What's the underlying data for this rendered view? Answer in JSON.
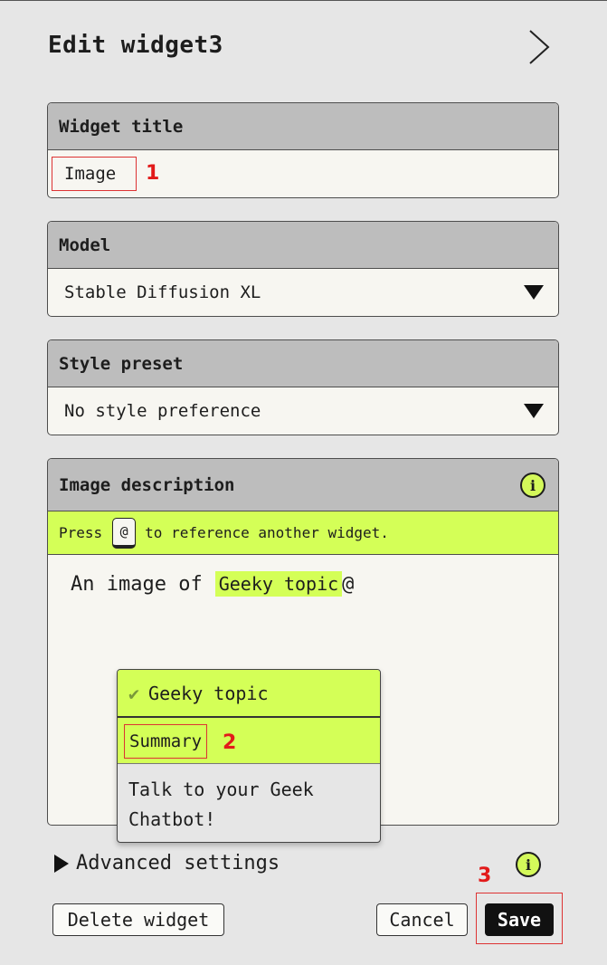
{
  "header": {
    "title": "Edit widget3"
  },
  "widget_title": {
    "label": "Widget title",
    "value": "Image"
  },
  "model": {
    "label": "Model",
    "value": "Stable Diffusion XL"
  },
  "style_preset": {
    "label": "Style preset",
    "value": "No style preference"
  },
  "image_description": {
    "label": "Image description",
    "hint_prefix": "Press",
    "hint_key": "@",
    "hint_suffix": "to reference another widget.",
    "text": "An image of",
    "mention": "Geeky topic",
    "trailing": "@"
  },
  "dropdown": {
    "items": [
      {
        "label": "Geeky topic",
        "selected": true
      },
      {
        "label": "Summary"
      },
      {
        "label": "Talk to your Geek Chatbot!"
      }
    ]
  },
  "advanced": {
    "label": "Advanced settings"
  },
  "buttons": {
    "delete": "Delete widget",
    "cancel": "Cancel",
    "save": "Save"
  },
  "annotations": [
    "1",
    "2",
    "3"
  ],
  "colors": {
    "accent": "#d4ff57",
    "header_gray": "#bdbdbd",
    "annotation_red": "#e21a1a"
  }
}
